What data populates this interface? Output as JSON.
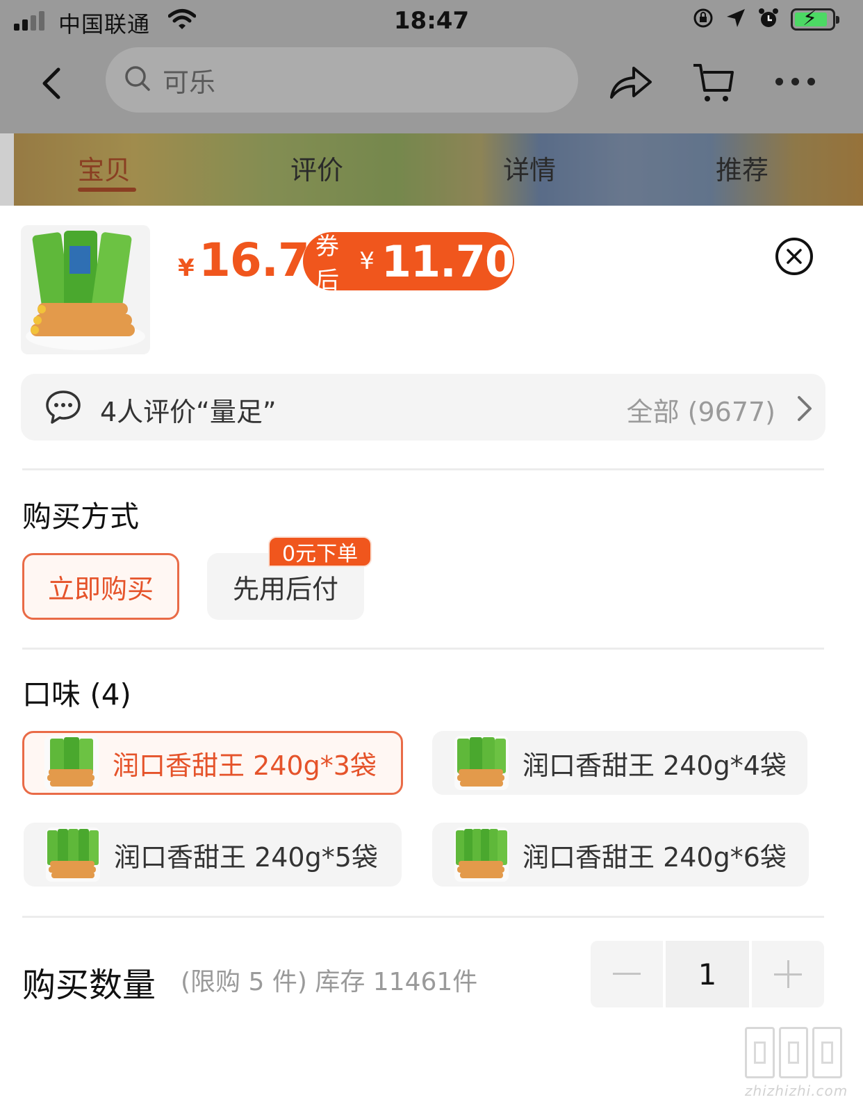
{
  "status_bar": {
    "carrier": "中国联通",
    "time": "18:47"
  },
  "nav": {
    "search_text": "可乐",
    "icons": [
      "back-icon",
      "search-icon",
      "share-icon",
      "cart-icon",
      "more-icon"
    ]
  },
  "tabs": [
    {
      "label": "宝贝",
      "active": true
    },
    {
      "label": "评价",
      "active": false
    },
    {
      "label": "详情",
      "active": false
    },
    {
      "label": "推荐",
      "active": false
    }
  ],
  "product": {
    "currency": "¥",
    "price": "16.7",
    "coupon_label": "券后",
    "coupon_currency": "¥",
    "coupon_price": "11.70"
  },
  "reviews": {
    "summary": "4人评价“量足”",
    "all_label": "全部 (9677)"
  },
  "purchase_method": {
    "title": "购买方式",
    "options": [
      {
        "label": "立即购买",
        "selected": true
      },
      {
        "label": "先用后付",
        "selected": false
      }
    ],
    "badge": "0元下单"
  },
  "flavor": {
    "title": "口味 (4)",
    "options": [
      {
        "label": "润口香甜王 240g*3袋",
        "selected": true
      },
      {
        "label": "润口香甜王 240g*4袋",
        "selected": false
      },
      {
        "label": "润口香甜王 240g*5袋",
        "selected": false
      },
      {
        "label": "润口香甜王 240g*6袋",
        "selected": false
      }
    ]
  },
  "quantity": {
    "title": "购买数量",
    "note": "(限购 5 件) 库存 11461件",
    "value": "1"
  },
  "watermark": {
    "text": "zhizhizhi.com"
  },
  "colors": {
    "accent": "#f0561d",
    "selected_border": "#e96b47",
    "option_bg": "#f4f4f4"
  }
}
